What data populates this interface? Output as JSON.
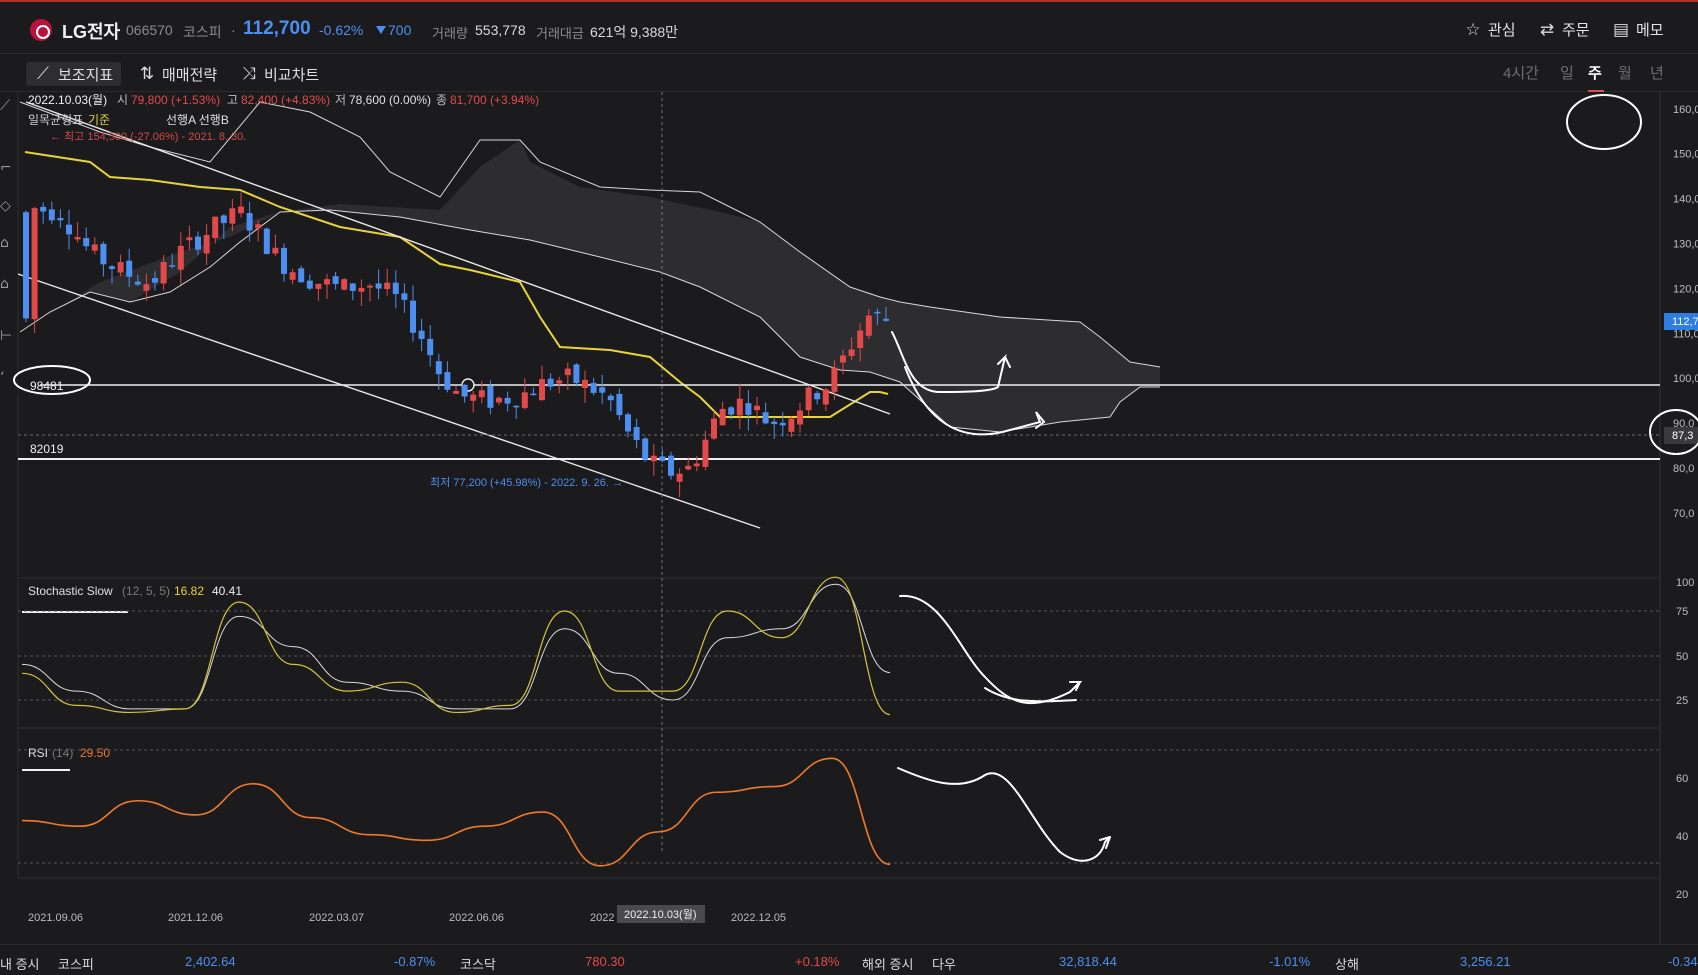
{
  "header": {
    "stock_name": "LG전자",
    "code": "066570",
    "market": "코스피",
    "separator": "·",
    "price": "112,700",
    "change_pct": "-0.62%",
    "change_amt": "700",
    "volume_label": "거래량",
    "volume": "553,778",
    "amount_label": "거래대금",
    "amount": "621억 9,388만",
    "watch_label": "관심",
    "order_label": "주문",
    "memo_label": "메모"
  },
  "toolbar": {
    "indicators_label": "보조지표",
    "strategy_label": "매매전략",
    "compare_label": "비교차트",
    "periods": [
      "4시간",
      "일",
      "주",
      "월",
      "년"
    ],
    "selected_period": "주"
  },
  "legend": {
    "date": "2022.10.03(월)",
    "open_label": "시",
    "open": "79,800 (+1.53%)",
    "high_label": "고",
    "high": "82,400 (+4.83%)",
    "low_label": "저",
    "low": "78,600 (0.00%)",
    "close_label": "종",
    "close": "81,700 (+3.94%)",
    "ichimoku_label": "일목균형표",
    "base_label": "기준",
    "span_label": "선행A 선행B",
    "max_note": "← 최고 154,500 (-27.06%) - 2021. 8. 30.",
    "min_note": "최저 77,200 (+45.98%) - 2022. 9. 26. →",
    "level1": "98481",
    "level2": "82019",
    "current_price_tag": "112,7",
    "cursor_price_tag": "87,3"
  },
  "stochastic": {
    "label": "Stochastic Slow",
    "params": "(12, 5, 5)",
    "k_value": "16.82",
    "d_value": "40.41",
    "axis": [
      "100",
      "75",
      "50",
      "25"
    ]
  },
  "rsi": {
    "label": "RSI",
    "params": "(14)",
    "value": "29.50",
    "axis": [
      "60",
      "40",
      "20"
    ]
  },
  "price_axis": [
    "160,0",
    "150,0",
    "140,0",
    "130,0",
    "120,0",
    "110,0",
    "100,0",
    "90,0",
    "80,0",
    "70,0"
  ],
  "x_axis": {
    "labels": [
      "2021.09.06",
      "2021.12.06",
      "2022.03.07",
      "2022.06.06",
      "2022",
      "2022.12.05"
    ],
    "cursor_label": "2022.10.03(월)"
  },
  "chart_data": {
    "type": "candlestick",
    "title": "LG전자",
    "x_range": [
      "2021.08.30",
      "2023.02.20"
    ],
    "y_range": [
      65000,
      165000
    ],
    "horizontal_levels": [
      98481,
      82019
    ],
    "series": [
      {
        "name": "기준",
        "values": [
          140000,
          130000,
          122000,
          118000,
          112000,
          105000,
          100000,
          93000,
          90000,
          94000,
          97000,
          99000
        ]
      },
      {
        "name": "선행A",
        "values": [
          140000,
          139000,
          138000,
          136000,
          131000,
          125000,
          118000,
          112000,
          105000,
          100000,
          97000,
          96000
        ]
      },
      {
        "name": "선행B",
        "values": [
          128000,
          140000,
          150000,
          148000,
          142000,
          133000,
          126000,
          121000,
          116000,
          114000,
          114000,
          104000
        ]
      },
      {
        "name": "Stochastic Slow %K",
        "values": [
          40,
          22,
          18,
          20,
          80,
          45,
          30,
          35,
          18,
          22,
          75,
          30,
          30,
          75,
          60,
          94,
          16.82
        ]
      },
      {
        "name": "Stochastic Slow %D",
        "values": [
          45,
          30,
          20,
          20,
          72,
          55,
          35,
          30,
          20,
          20,
          65,
          40,
          25,
          60,
          65,
          90,
          40.41
        ]
      },
      {
        "name": "RSI",
        "values": [
          45,
          43,
          52,
          47,
          58,
          46,
          40,
          38,
          43,
          48,
          29,
          41,
          55,
          57,
          67,
          29.5
        ]
      }
    ],
    "candles_ohlc_weekly_samples": [
      {
        "x": "2021.08.30",
        "o": 141000,
        "h": 154500,
        "l": 133000,
        "c": 137000
      },
      {
        "x": "2021.12.06",
        "o": 126000,
        "h": 135000,
        "l": 121000,
        "c": 132000
      },
      {
        "x": "2022.03.07",
        "o": 123000,
        "h": 128000,
        "l": 119000,
        "c": 121000
      },
      {
        "x": "2022.06.06",
        "o": 100000,
        "h": 102000,
        "l": 90000,
        "c": 92000
      },
      {
        "x": "2022.09.26",
        "o": 80000,
        "h": 82000,
        "l": 77200,
        "c": 78600
      },
      {
        "x": "2022.10.03",
        "o": 79800,
        "h": 82400,
        "l": 78600,
        "c": 81700
      },
      {
        "x": "2022.12.05",
        "o": 92000,
        "h": 95000,
        "l": 89000,
        "c": 93000
      },
      {
        "x": "2023.02.20",
        "o": 113400,
        "h": 115000,
        "l": 111000,
        "c": 112700
      }
    ]
  },
  "statusbar": {
    "domestic_label": "내 증시",
    "kospi_label": "코스피",
    "kospi_value": "2,402.64",
    "kospi_pct": "-0.87%",
    "kosdaq_label": "코스닥",
    "kosdaq_value": "780.30",
    "kosdaq_pct": "+0.18%",
    "overseas_label": "해외 증시",
    "dow_label": "다우",
    "dow_value": "32,818.44",
    "dow_pct": "-1.01%",
    "shanghai_label": "상해",
    "shanghai_value": "3,256.21",
    "shanghai_pct": "-0.34"
  },
  "colors": {
    "up": "#e2494a",
    "down": "#4d8ff0",
    "base_line": "#e8d33a",
    "cloud_fill": "#2d2d30",
    "stoch_k": "#d7c23d",
    "stoch_d": "#d9d9d9",
    "rsi": "#ee7a2a"
  }
}
